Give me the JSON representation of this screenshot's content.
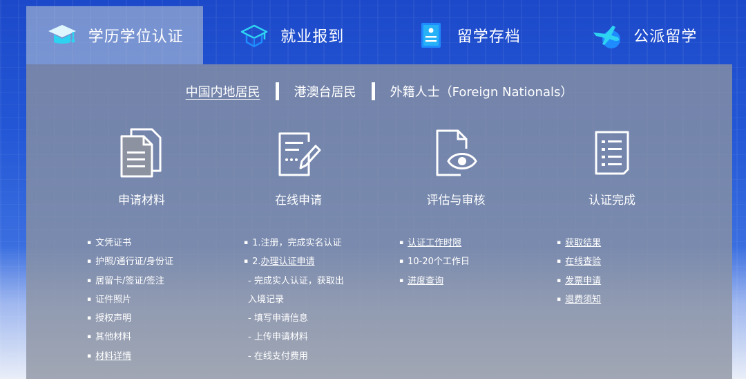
{
  "tabs": [
    {
      "label": "学历学位认证",
      "icon": "graduation-cap-icon",
      "active": true
    },
    {
      "label": "就业报到",
      "icon": "mortarboard-book-icon"
    },
    {
      "label": "留学存档",
      "icon": "document-archive-icon"
    },
    {
      "label": "公派留学",
      "icon": "airplane-globe-icon"
    }
  ],
  "regions": [
    {
      "label": "中国内地居民",
      "active": true
    },
    {
      "label": "港澳台居民"
    },
    {
      "label": "外籍人士（Foreign Nationals）"
    }
  ],
  "steps": [
    {
      "title": "申请材料",
      "icon": "documents-icon",
      "items": [
        "文凭证书",
        "护照/通行证/身份证",
        "居留卡/签证/签注",
        "证件照片",
        "授权声明",
        "其他材料",
        "材料详情"
      ]
    },
    {
      "title": "在线申请",
      "icon": "form-pen-icon",
      "items": [
        "1.注册，完成实名认证",
        "2.",
        "办理认证申请",
        "- 完成实人认证，获取出",
        "入境记录",
        "- 填写申请信息",
        "- 上传申请材料",
        "- 在线支付费用"
      ]
    },
    {
      "title": "评估与审核",
      "icon": "document-eye-icon",
      "items": [
        "认证工作时限",
        "10-20个工作日",
        "进度查询"
      ]
    },
    {
      "title": "认证完成",
      "icon": "checklist-icon",
      "items": [
        "获取结果",
        "在线查验",
        "发票申请",
        "退费须知"
      ]
    }
  ],
  "colors": {
    "background_blue": "#1c49c9",
    "panel_gray": "#8c92a0",
    "text": "#ffffff",
    "icon_cyan": "#2fd3f2",
    "icon_blue": "#1e8bff"
  }
}
